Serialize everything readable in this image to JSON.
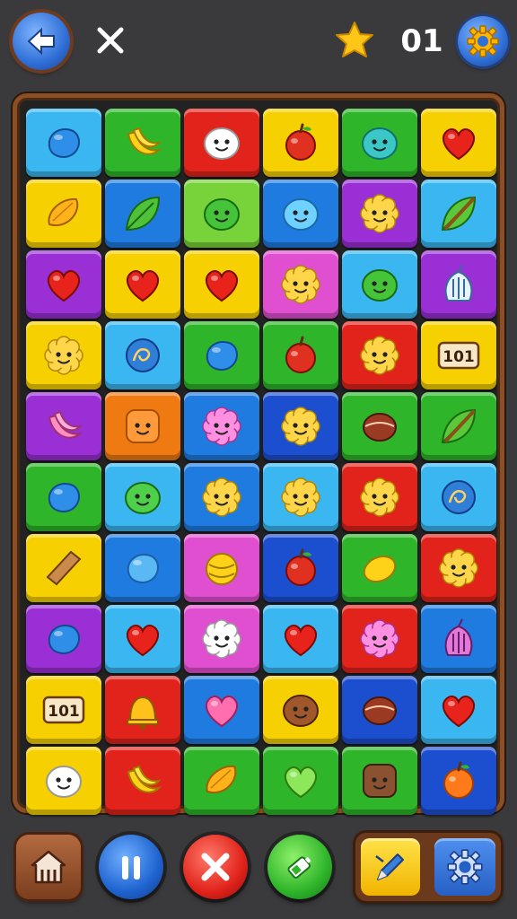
{
  "header": {
    "counter": "01",
    "back_icon": "arrow-left-icon",
    "close_icon": "close-icon",
    "star_icon": "star-icon",
    "settings_icon": "gear-icon"
  },
  "palette": {
    "blue": "#1f7be0",
    "sky": "#3ab7f0",
    "green": "#2fb52a",
    "lime": "#78d23a",
    "red": "#e1231b",
    "yellow": "#f6d000",
    "purple": "#9a2fd6",
    "pink": "#e04fd0",
    "orange": "#f07a12",
    "navy": "#1c4fd0"
  },
  "board": {
    "rows": [
      [
        {
          "color": "sky",
          "icon": "blue-blob"
        },
        {
          "color": "green",
          "icon": "banana"
        },
        {
          "color": "red",
          "icon": "white-face"
        },
        {
          "color": "yellow",
          "icon": "red-apple"
        },
        {
          "color": "green",
          "icon": "teal-blob"
        },
        {
          "color": "yellow",
          "icon": "red-heart"
        }
      ],
      [
        {
          "color": "yellow",
          "icon": "mango"
        },
        {
          "color": "blue",
          "icon": "green-leaf"
        },
        {
          "color": "lime",
          "icon": "green-blob"
        },
        {
          "color": "blue",
          "icon": "sky-smiley"
        },
        {
          "color": "purple",
          "icon": "yellow-flower"
        },
        {
          "color": "sky",
          "icon": "leaf-stick"
        }
      ],
      [
        {
          "color": "purple",
          "icon": "red-heart"
        },
        {
          "color": "yellow",
          "icon": "red-heart"
        },
        {
          "color": "yellow",
          "icon": "red-heart"
        },
        {
          "color": "pink",
          "icon": "yellow-flower"
        },
        {
          "color": "sky",
          "icon": "green-blob"
        },
        {
          "color": "purple",
          "icon": "white-plant"
        }
      ],
      [
        {
          "color": "yellow",
          "icon": "yellow-flower"
        },
        {
          "color": "sky",
          "icon": "blue-swirl"
        },
        {
          "color": "green",
          "icon": "blue-blob"
        },
        {
          "color": "green",
          "icon": "red-apple"
        },
        {
          "color": "red",
          "icon": "yellow-flower"
        },
        {
          "color": "yellow",
          "icon": "counter-box"
        }
      ],
      [
        {
          "color": "purple",
          "icon": "pink-bananas"
        },
        {
          "color": "orange",
          "icon": "orange-square"
        },
        {
          "color": "blue",
          "icon": "pink-flower"
        },
        {
          "color": "navy",
          "icon": "yellow-flower"
        },
        {
          "color": "green",
          "icon": "brown-ball"
        },
        {
          "color": "green",
          "icon": "leaf-stick"
        }
      ],
      [
        {
          "color": "green",
          "icon": "blue-blob"
        },
        {
          "color": "sky",
          "icon": "green-smiley"
        },
        {
          "color": "blue",
          "icon": "yellow-flower"
        },
        {
          "color": "sky",
          "icon": "yellow-flower"
        },
        {
          "color": "red",
          "icon": "yellow-flower"
        },
        {
          "color": "sky",
          "icon": "blue-swirl"
        }
      ],
      [
        {
          "color": "yellow",
          "icon": "brown-bar"
        },
        {
          "color": "blue",
          "icon": "sky-blob"
        },
        {
          "color": "pink",
          "icon": "yellow-ball"
        },
        {
          "color": "navy",
          "icon": "red-apple"
        },
        {
          "color": "green",
          "icon": "yellow-lemon"
        },
        {
          "color": "red",
          "icon": "yellow-flower"
        }
      ],
      [
        {
          "color": "purple",
          "icon": "blue-blob"
        },
        {
          "color": "sky",
          "icon": "red-heart"
        },
        {
          "color": "pink",
          "icon": "white-flower"
        },
        {
          "color": "sky",
          "icon": "red-heart"
        },
        {
          "color": "red",
          "icon": "pink-flower"
        },
        {
          "color": "blue",
          "icon": "pink-plant"
        }
      ],
      [
        {
          "color": "yellow",
          "icon": "counter-box"
        },
        {
          "color": "red",
          "icon": "bell"
        },
        {
          "color": "blue",
          "icon": "pink-heart"
        },
        {
          "color": "yellow",
          "icon": "brown-face"
        },
        {
          "color": "navy",
          "icon": "brown-ball"
        },
        {
          "color": "sky",
          "icon": "red-heart"
        }
      ],
      [
        {
          "color": "yellow",
          "icon": "white-face"
        },
        {
          "color": "red",
          "icon": "banana"
        },
        {
          "color": "green",
          "icon": "mango"
        },
        {
          "color": "green",
          "icon": "lime-heart"
        },
        {
          "color": "green",
          "icon": "brown-square"
        },
        {
          "color": "navy",
          "icon": "orange-apple"
        }
      ]
    ]
  },
  "toolbar": {
    "home_icon": "home-icon",
    "pause_icon": "pause-icon",
    "cancel_icon": "close-icon",
    "boost_icon": "battery-icon",
    "edit_icon": "pencil-icon",
    "settings_icon": "gear-icon"
  }
}
